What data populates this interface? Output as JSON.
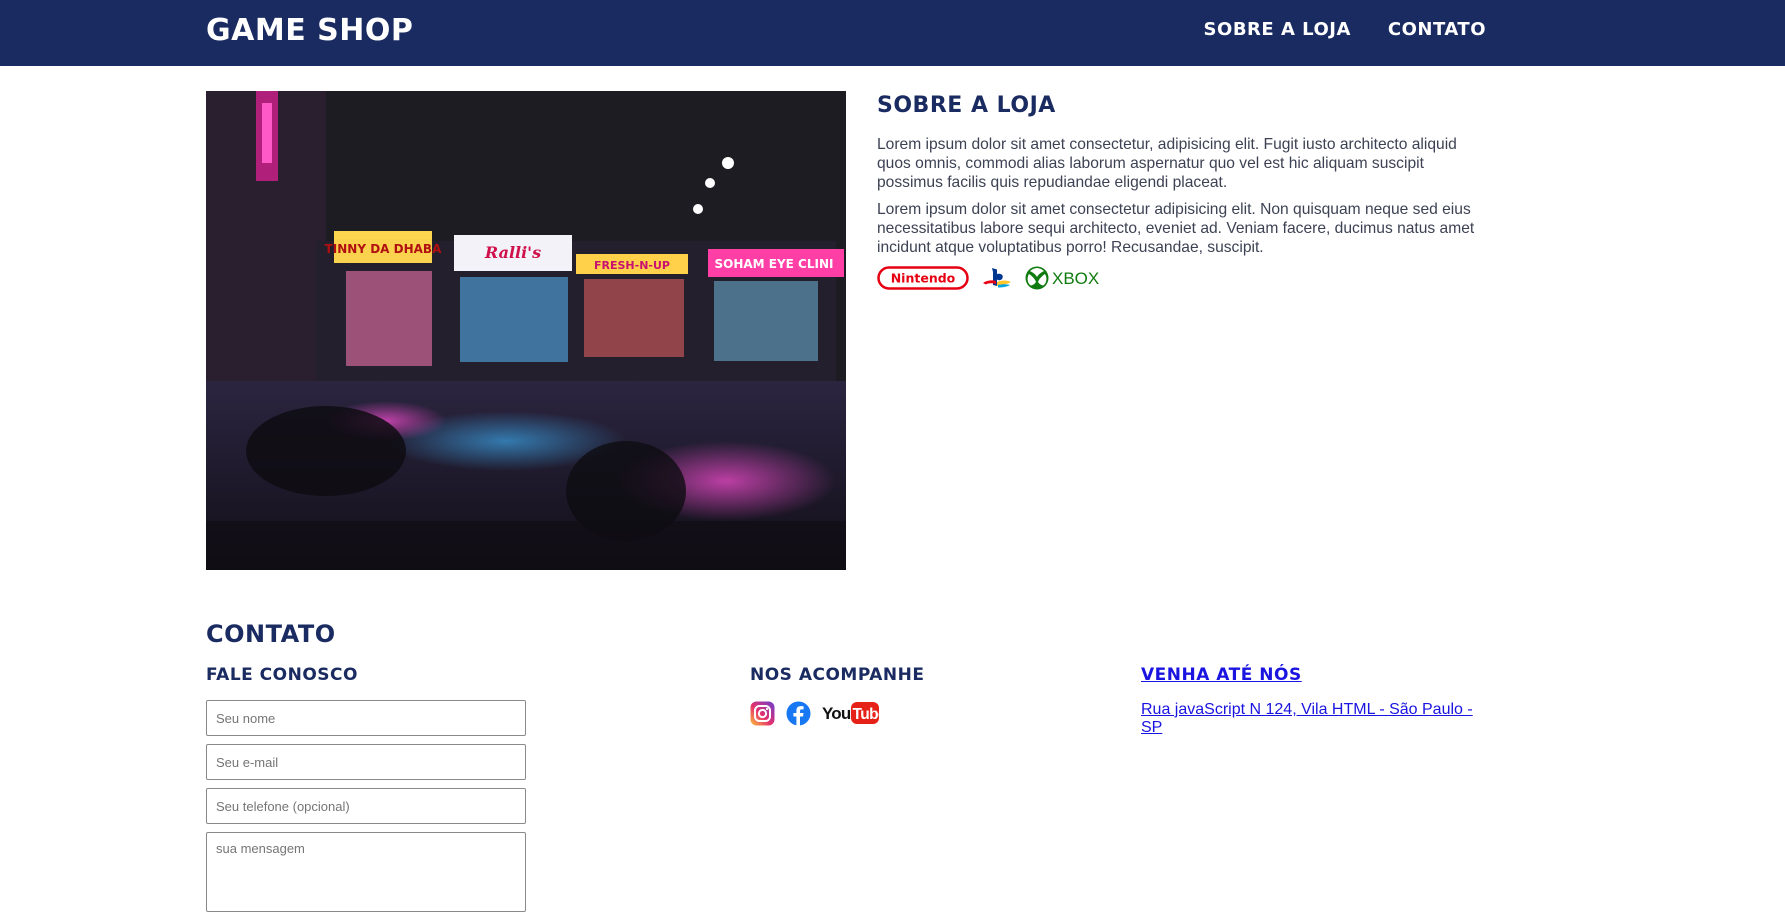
{
  "header": {
    "brand": "GAME SHOP",
    "nav": [
      {
        "label": "SOBRE A LOJA"
      },
      {
        "label": "CONTATO"
      }
    ]
  },
  "about": {
    "title": "SOBRE A LOJA",
    "paragraphs": [
      "Lorem ipsum dolor sit amet consectetur, adipisicing elit. Fugit iusto architecto aliquid quos omnis, commodi alias laborum aspernatur quo vel est hic aliquam suscipit possimus facilis quis repudiandae eligendi placeat.",
      "Lorem ipsum dolor sit amet consectetur adipisicing elit. Non quisquam neque sed eius necessitatibus labore sequi architecto, eveniet ad. Veniam facere, ducimus natus amet incidunt atque voluptatibus porro! Recusandae, suscipit."
    ],
    "brands": {
      "nintendo": "Nintendo",
      "playstation_icon": "playstation-icon",
      "xbox": "XBOX"
    }
  },
  "hero": {
    "image_icon": "neon-street-photo",
    "signs": [
      "TINNY DA DHABA",
      "Ralli's",
      "FRESH-N-UP",
      "SOHAM EYE CLINI"
    ]
  },
  "contact": {
    "title": "CONTATO",
    "form": {
      "title": "FALE CONOSCO",
      "name_placeholder": "Seu nome",
      "email_placeholder": "Seu e-mail",
      "phone_placeholder": "Seu telefone (opcional)",
      "message_placeholder": "sua mensagem"
    },
    "social": {
      "title": "NOS ACOMPANHE",
      "icons": [
        "instagram-icon",
        "facebook-icon",
        "youtube-icon"
      ],
      "youtube_text": "YouTube"
    },
    "visit": {
      "title": "VENHA ATÉ NÓS",
      "address": "Rua javaScript N 124, Vila HTML - São Paulo - SP"
    }
  },
  "colors": {
    "header_bg": "#1a2b61",
    "heading": "#1a2b61",
    "link": "#1a14e0"
  }
}
